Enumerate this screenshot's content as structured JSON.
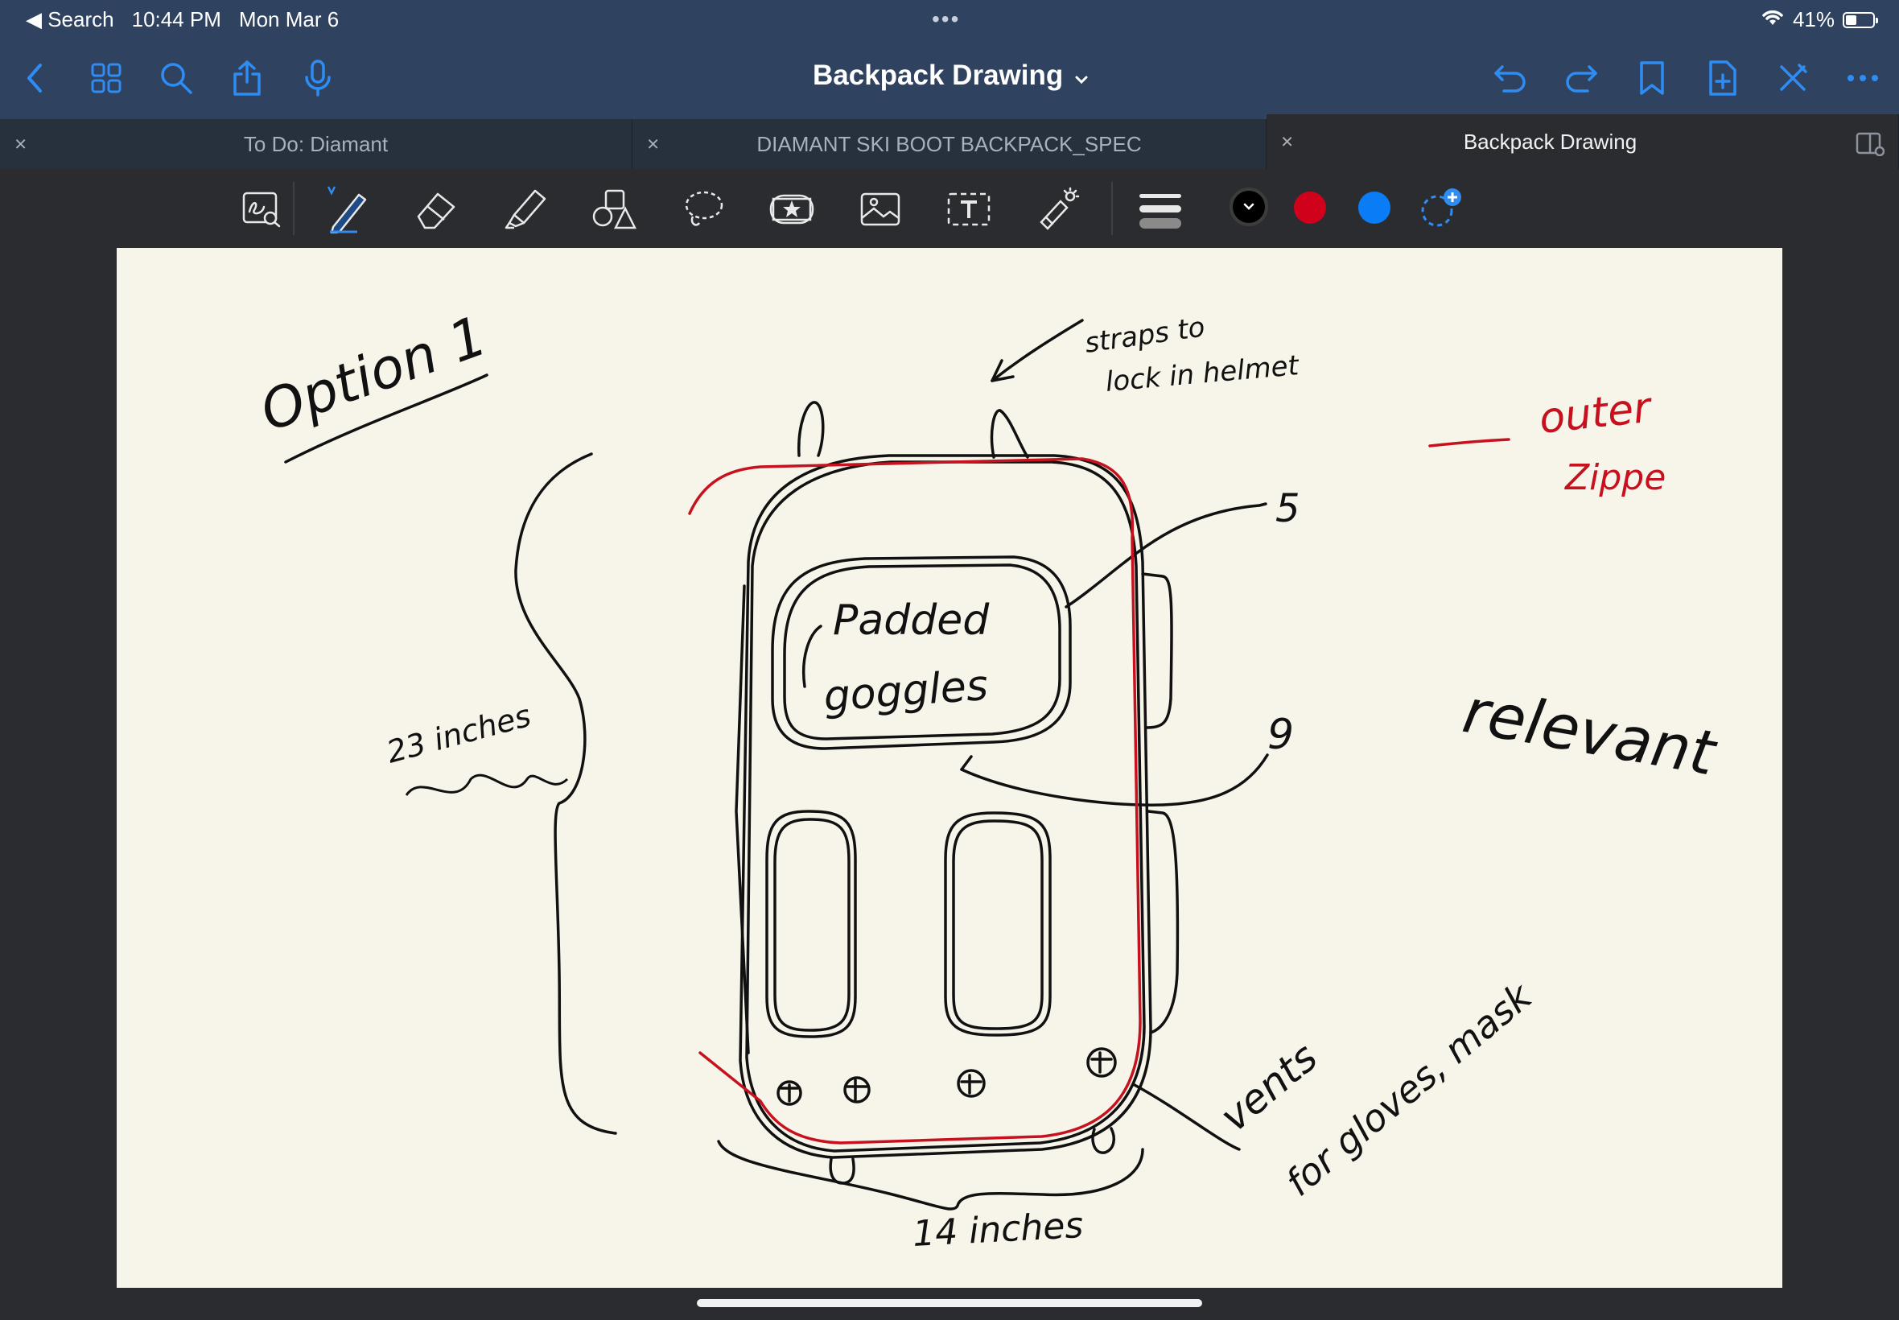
{
  "status_bar": {
    "back_app": "◀ Search",
    "time": "10:44 PM",
    "date": "Mon Mar 6",
    "battery": "41%",
    "battery_level": 0.41
  },
  "nav": {
    "title": "Backpack Drawing",
    "title_chevron": "⌄",
    "left_icons": [
      "back-icon",
      "grid-icon",
      "search-icon",
      "share-icon",
      "microphone-icon"
    ],
    "right_icons": [
      "undo-icon",
      "redo-icon",
      "bookmark-icon",
      "add-page-icon",
      "close-pen-icon",
      "more-icon"
    ]
  },
  "tabs": [
    {
      "label": "To Do: Diamant",
      "close": "×",
      "active": false
    },
    {
      "label": "DIAMANT SKI BOOT BACKPACK_SPEC",
      "close": "×",
      "active": false
    },
    {
      "label": "Backpack Drawing",
      "close": "×",
      "active": true
    }
  ],
  "toolbar": {
    "tools": [
      "zoom-lasso-icon",
      "pen-icon",
      "eraser-icon",
      "highlighter-icon",
      "shapes-icon",
      "lasso-icon",
      "sticker-icon",
      "image-icon",
      "text-icon",
      "laser-pointer-icon"
    ],
    "active_tool": "pen",
    "colors": [
      "#000000",
      "#d0021b",
      "#0a7cf5"
    ],
    "selected_color": "#000000",
    "accent": "#2f8cf3"
  },
  "handwriting": {
    "option_label": "Option 1",
    "straps_note_line1": "straps to",
    "straps_note_line2": "lock in helmet",
    "outer_zipper_line1": "outer",
    "outer_zipper_line2": "Zippe",
    "padded_line1": "Padded",
    "padded_line2": "goggles",
    "height_label": "23 inches",
    "mark_5": "5",
    "mark_9": "9",
    "relevant": "relevant",
    "vents_line1": "vents",
    "vents_line2": "for gloves, mask",
    "width_label": "14 inches"
  }
}
